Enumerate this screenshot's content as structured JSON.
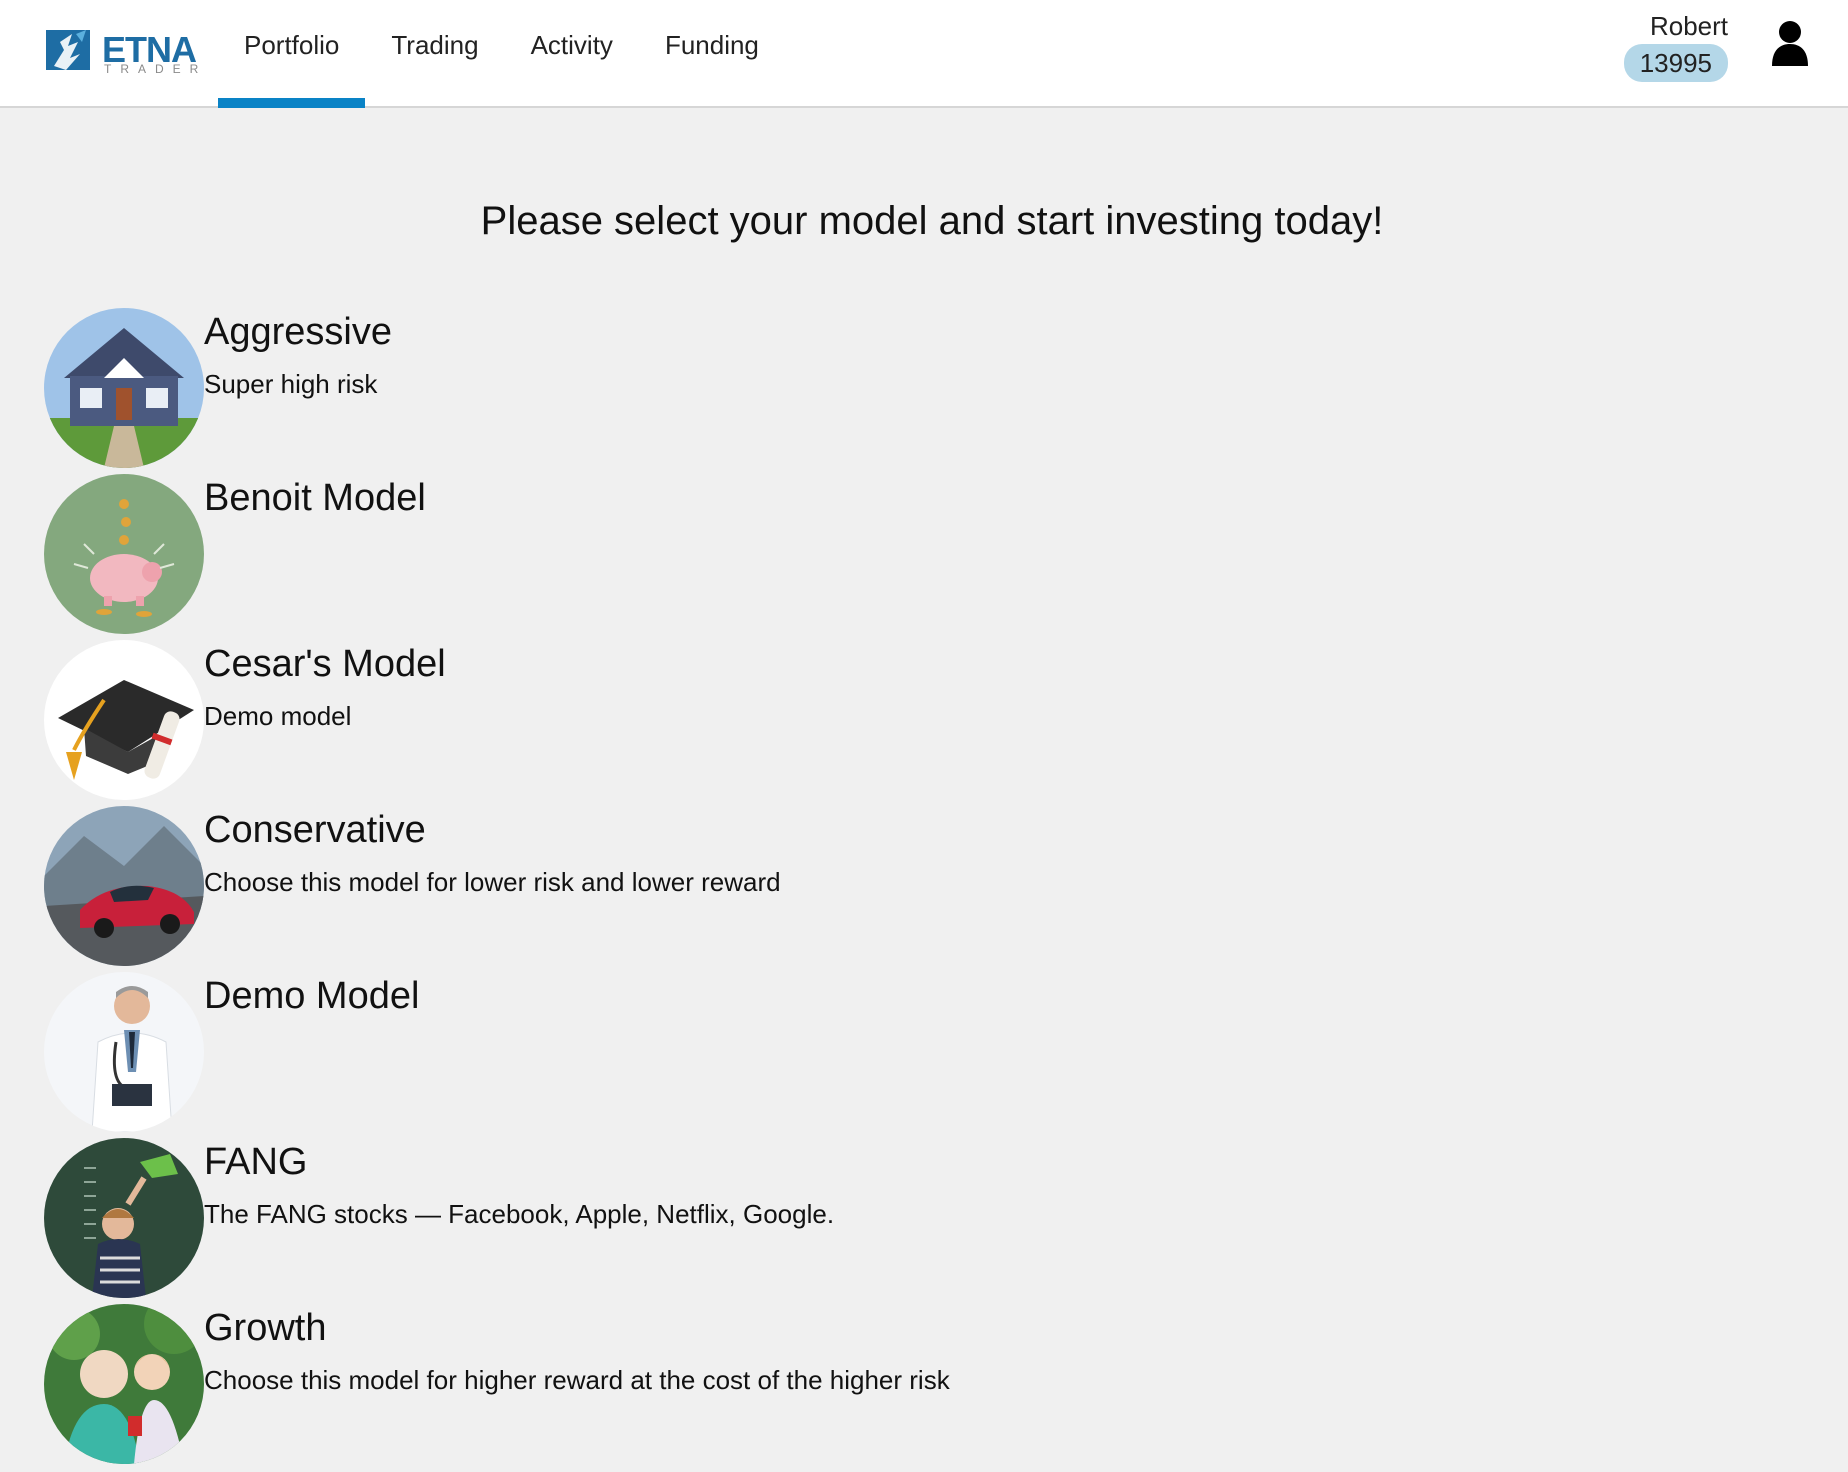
{
  "brand": {
    "name": "ETNA",
    "sub": "TRADER",
    "color": "#1e6da4"
  },
  "nav": {
    "tabs": [
      {
        "label": "Portfolio",
        "active": true
      },
      {
        "label": "Trading",
        "active": false
      },
      {
        "label": "Activity",
        "active": false
      },
      {
        "label": "Funding",
        "active": false
      }
    ],
    "accent": "#0a83c6"
  },
  "user": {
    "name": "Robert",
    "account": "13995",
    "icon": "user-icon"
  },
  "headline": "Please select your model and start investing today!",
  "models": [
    {
      "name": "Aggressive",
      "description": "Super high risk",
      "image": "house-photo"
    },
    {
      "name": "Benoit Model",
      "description": "",
      "image": "piggy-bank-photo"
    },
    {
      "name": "Cesar's Model",
      "description": "Demo model",
      "image": "graduation-cap-photo"
    },
    {
      "name": "Conservative",
      "description": "Choose this model for lower risk and lower reward",
      "image": "sports-car-photo"
    },
    {
      "name": "Demo Model",
      "description": "",
      "image": "doctor-photo"
    },
    {
      "name": "FANG",
      "description": "The FANG stocks — Facebook, Apple, Netflix, Google.",
      "image": "boy-watering-can-photo"
    },
    {
      "name": "Growth",
      "description": "Choose this model for higher reward at the cost of the higher risk",
      "image": "grandmother-child-photo"
    }
  ]
}
